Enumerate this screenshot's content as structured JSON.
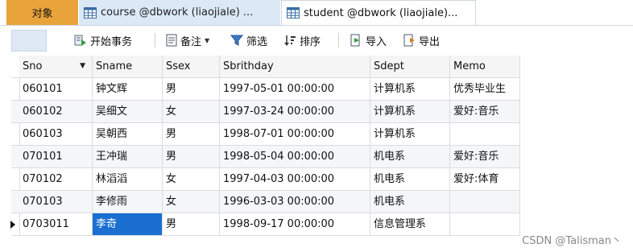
{
  "tabs": {
    "objects": "对象",
    "course": "course @dbwork (liaojiale) ...",
    "student": "student @dbwork (liaojiale)..."
  },
  "toolbar": {
    "begin_transaction": "开始事务",
    "memo": "备注",
    "filter": "筛选",
    "sort": "排序",
    "import": "导入",
    "export": "导出"
  },
  "table": {
    "columns": [
      "Sno",
      "Sname",
      "Ssex",
      "Sbrithday",
      "Sdept",
      "Memo"
    ],
    "sort_indicator": "▼",
    "rows": [
      [
        "060101",
        "钟文辉",
        "男",
        "1997-05-01 00:00:00",
        "计算机系",
        "优秀毕业生"
      ],
      [
        "060102",
        "吴细文",
        "女",
        "1997-03-24 00:00:00",
        "计算机系",
        "爱好:音乐"
      ],
      [
        "060103",
        "吴朝西",
        "男",
        "1998-07-01 00:00:00",
        "计算机系",
        ""
      ],
      [
        "070101",
        "王冲瑞",
        "男",
        "1998-05-04 00:00:00",
        "机电系",
        "爱好:音乐"
      ],
      [
        "070102",
        "林滔滔",
        "女",
        "1997-04-03 00:00:00",
        "机电系",
        "爱好:体育"
      ],
      [
        "070103",
        "李修雨",
        "女",
        "1996-03-03 00:00:00",
        "机电系",
        ""
      ],
      [
        "0703011",
        "李奇",
        "男",
        "1998-09-17 00:00:00",
        "信息管理系",
        ""
      ]
    ],
    "current_row": 6,
    "selected_cell": "Sname"
  },
  "watermark": "CSDN @Talisman丶",
  "colors": {
    "objects_tab": "#e8a33a",
    "selection": "#1a6fd1",
    "inactive_tab": "#dbe9f7"
  }
}
